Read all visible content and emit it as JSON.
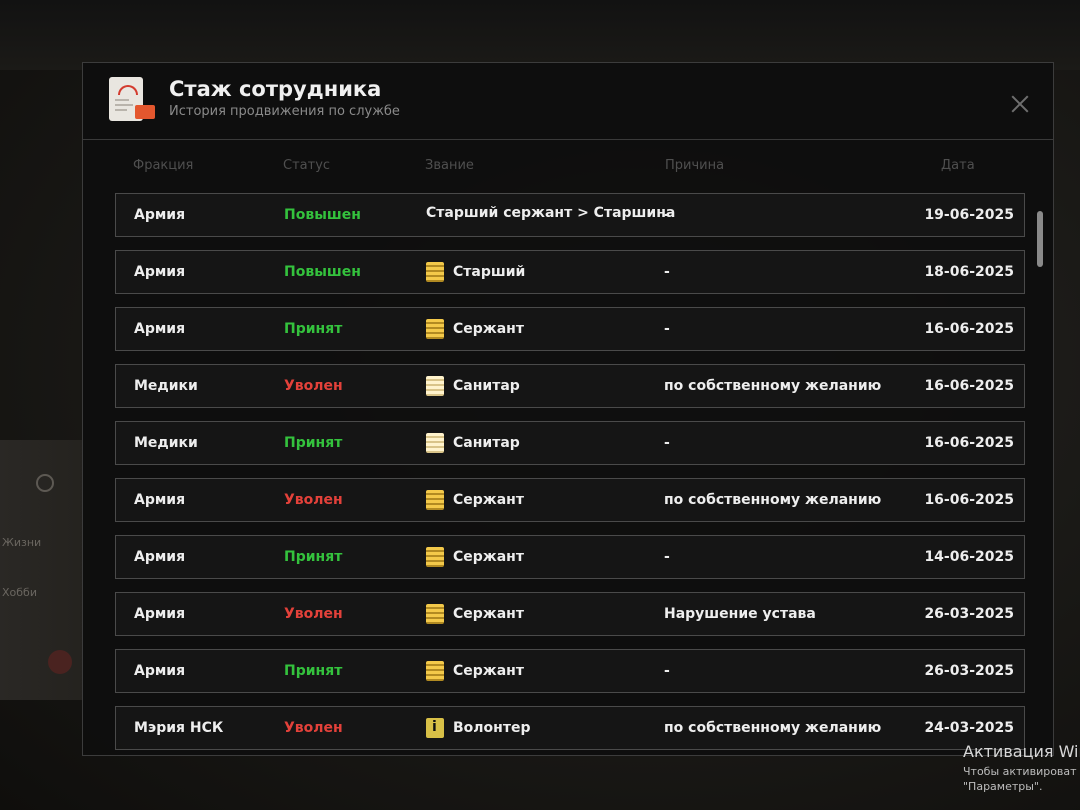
{
  "window": {
    "title": "Стаж сотрудника",
    "subtitle": "История продвижения по службе"
  },
  "columns": {
    "faction": "Фракция",
    "status": "Статус",
    "rank": "Звание",
    "reason": "Причина",
    "date": "Дата"
  },
  "colors": {
    "promoted": "#34c23d",
    "hired": "#34c23d",
    "fired": "#e3413a"
  },
  "rows": [
    {
      "faction": "Армия",
      "status": "Повышен",
      "rank": "Старший сержант > Старшина",
      "rank_icon": "",
      "reason": "-",
      "date": "19-06-2025"
    },
    {
      "faction": "Армия",
      "status": "Повышен",
      "rank": "Старший",
      "rank_icon": "rank-chevrons-icon",
      "reason": "-",
      "date": "18-06-2025"
    },
    {
      "faction": "Армия",
      "status": "Принят",
      "rank": "Сержант",
      "rank_icon": "rank-chevrons-icon",
      "reason": "-",
      "date": "16-06-2025"
    },
    {
      "faction": "Медики",
      "status": "Уволен",
      "rank": "Санитар",
      "rank_icon": "rank-chevrons-white-icon",
      "reason": "по собственному желанию",
      "date": "16-06-2025"
    },
    {
      "faction": "Медики",
      "status": "Принят",
      "rank": "Санитар",
      "rank_icon": "rank-chevrons-white-icon",
      "reason": "-",
      "date": "16-06-2025"
    },
    {
      "faction": "Армия",
      "status": "Уволен",
      "rank": "Сержант",
      "rank_icon": "rank-chevrons-icon",
      "reason": "по собственному желанию",
      "date": "16-06-2025"
    },
    {
      "faction": "Армия",
      "status": "Принят",
      "rank": "Сержант",
      "rank_icon": "rank-chevrons-icon",
      "reason": "-",
      "date": "14-06-2025"
    },
    {
      "faction": "Армия",
      "status": "Уволен",
      "rank": "Сержант",
      "rank_icon": "rank-chevrons-icon",
      "reason": "Нарушение устава",
      "date": "26-03-2025"
    },
    {
      "faction": "Армия",
      "status": "Принят",
      "rank": "Сержант",
      "rank_icon": "rank-chevrons-icon",
      "reason": "-",
      "date": "26-03-2025"
    },
    {
      "faction": "Мэрия НСК",
      "status": "Уволен",
      "rank": "Волонтер",
      "rank_icon": "info-badge-icon",
      "reason": "по собственному желанию",
      "date": "24-03-2025"
    }
  ],
  "background": {
    "left_text_1": "Жизни",
    "left_text_2": "Хобби"
  },
  "os_notice": {
    "line1": "Активация Win",
    "line2": "Чтобы активироват",
    "line3": "\"Параметры\"."
  }
}
